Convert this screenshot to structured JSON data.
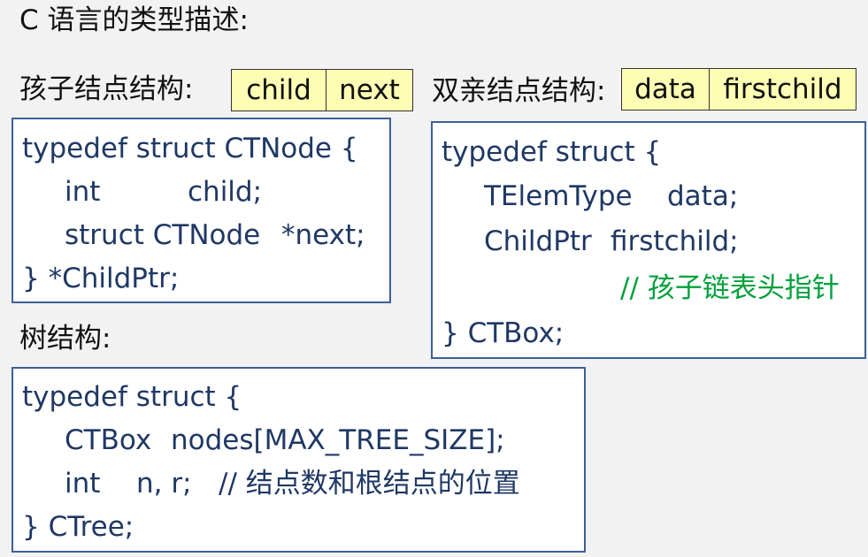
{
  "title": "C 语言的类型描述:",
  "child_node": {
    "label": "孩子结点结构:",
    "fields": [
      "child",
      "next"
    ],
    "code": [
      "typedef struct CTNode {",
      "int",
      "child;",
      "struct CTNode",
      "*next;",
      "} *ChildPtr;"
    ]
  },
  "parent_node": {
    "label": "双亲结点结构:",
    "fields": [
      "data",
      "firstchild"
    ],
    "code": [
      "typedef struct {",
      "TElemType",
      "data;",
      "ChildPtr",
      "firstchild;",
      "// 孩子链表头指针",
      "} CTBox;"
    ]
  },
  "tree": {
    "label": "树结构:",
    "code": [
      "typedef struct {",
      "CTBox",
      "nodes[MAX_TREE_SIZE];",
      "int",
      "n, r;",
      "// 结点数和根结点的位置",
      "} CTree;"
    ]
  }
}
